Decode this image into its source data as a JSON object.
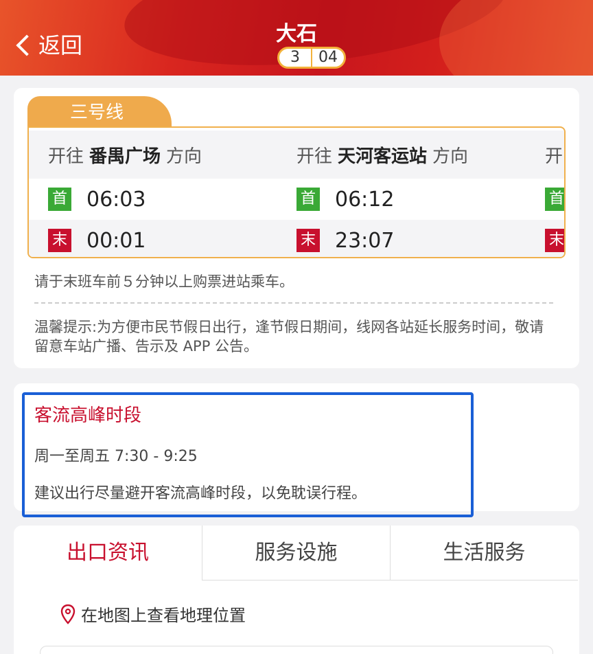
{
  "header": {
    "back_label": "返回",
    "station_name": "大石",
    "line_number": "3",
    "station_code": "04"
  },
  "schedule": {
    "line_tab": "三号线",
    "directions": [
      {
        "prefix": "开往",
        "dest": "番禺广场",
        "suffix": "方向",
        "first": "06:03",
        "last": "00:01"
      },
      {
        "prefix": "开往",
        "dest": "天河客运站",
        "suffix": "方向",
        "first": "06:12",
        "last": "23:07"
      },
      {
        "prefix": "开"
      }
    ],
    "first_tag": "首",
    "last_tag": "末",
    "note": "请于末班车前５分钟以上购票进站乘车。",
    "tip": "温馨提示:为方便市民节假日出行，逢节假日期间，线网各站延长服务时间，敬请留意车站广播、告示及 APP 公告。"
  },
  "peak": {
    "title": "客流高峰时段",
    "time": "周一至周五  7:30 - 9:25",
    "advice": "建议出行尽量避开客流高峰时段，以免耽误行程。"
  },
  "tabs": [
    "出口资讯",
    "服务设施",
    "生活服务"
  ],
  "map_link": "在地图上查看地理位置",
  "colors": {
    "accent": "#c8102e",
    "first_green": "#3aa936",
    "line_orange": "#efaa4c",
    "highlight_blue": "#1a5fd6"
  }
}
